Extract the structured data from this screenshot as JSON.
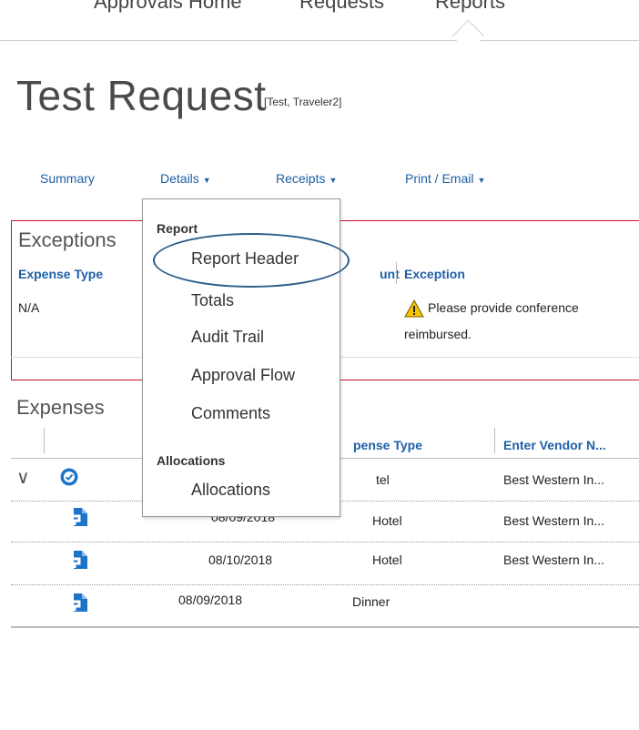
{
  "topnav": {
    "items": [
      "Approvals Home",
      "Requests",
      "Reports"
    ]
  },
  "header": {
    "title": "Test Request",
    "subtitle": "[Test, Traveler2]"
  },
  "tabs": [
    {
      "label": "Summary"
    },
    {
      "label": "Details"
    },
    {
      "label": "Receipts"
    },
    {
      "label": "Print / Email"
    }
  ],
  "exceptions": {
    "title": "Exceptions",
    "columns": [
      "Expense Type",
      "unt",
      "Exception"
    ],
    "row": {
      "expense_type": "N/A",
      "exception_line1": "Please provide conference",
      "exception_line2": "reimbursed."
    }
  },
  "expenses": {
    "title": "Expenses",
    "columns": [
      "pense Type",
      "Enter Vendor N..."
    ],
    "rows": [
      {
        "date": "",
        "type": "tel",
        "vendor": "Best Western In..."
      },
      {
        "date": "08/09/2018",
        "type": "Hotel",
        "vendor": "Best Western In..."
      },
      {
        "date": "08/10/2018",
        "type": "Hotel",
        "vendor": "Best Western In..."
      },
      {
        "date": "08/09/2018",
        "type": "Dinner",
        "vendor": ""
      }
    ]
  },
  "menu": {
    "groups": [
      {
        "label": "Report",
        "items": [
          "Report Header",
          "Totals",
          "Audit Trail",
          "Approval Flow",
          "Comments"
        ]
      },
      {
        "label": "Allocations",
        "items": [
          "Allocations"
        ]
      }
    ]
  },
  "colors": {
    "link": "#1f5fa7",
    "exception_border": "#c8102e",
    "icon_blue": "#1b74c8",
    "highlight": "#2e5d8a"
  }
}
